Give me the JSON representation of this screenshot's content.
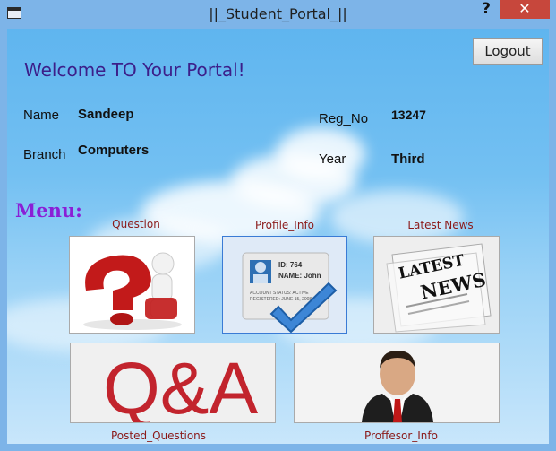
{
  "window": {
    "title": "||_Student_Portal_||",
    "help_glyph": "?",
    "close_glyph": "✕"
  },
  "header": {
    "welcome": "Welcome TO Your Portal!",
    "logout_label": "Logout"
  },
  "student": {
    "name_label": "Name",
    "name_value": "Sandeep",
    "branch_label": "Branch",
    "branch_value": "Computers",
    "reg_label": "Reg_No",
    "reg_value": "13247",
    "year_label": "Year",
    "year_value": "Third"
  },
  "menu": {
    "title": "Menu:",
    "items": [
      {
        "label": "Question",
        "icon": "question-mark-icon"
      },
      {
        "label": "Profile_Info",
        "icon": "id-card-check-icon",
        "id_line": "ID: 764",
        "name_line": "NAME: John",
        "status_line": "ACCOUNT STATUS: ACTIVE",
        "reg_line": "REGISTERED: JUNE 15, 2008"
      },
      {
        "label": "Latest News",
        "icon": "newspaper-icon",
        "word1": "LATEST",
        "word2": "NEWS"
      },
      {
        "label": "Posted_Questions",
        "icon": "qa-icon",
        "text": "Q&A"
      },
      {
        "label": "Proffesor_Info",
        "icon": "professor-icon"
      }
    ]
  }
}
